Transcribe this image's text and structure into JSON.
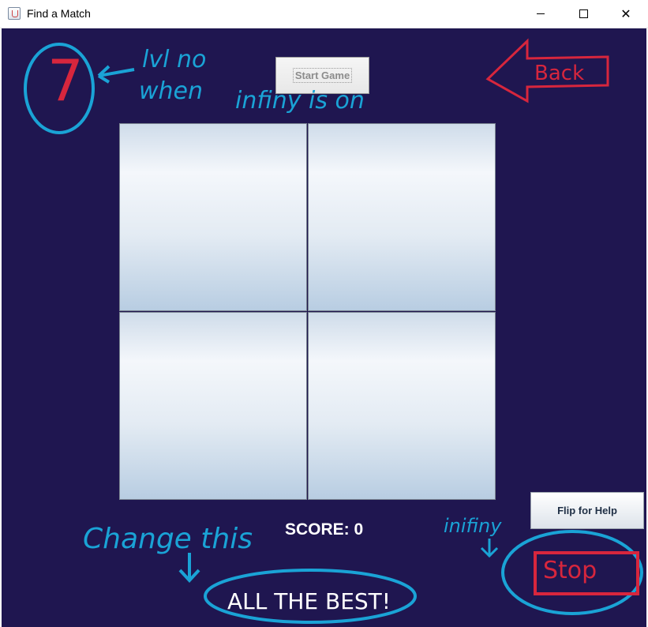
{
  "window": {
    "title": "Find a Match",
    "icons": {
      "app": "java-cup-icon",
      "minimize": "minimize-icon",
      "maximize": "maximize-icon",
      "close": "close-icon"
    }
  },
  "game": {
    "start_label": "Start Game",
    "score_label": "SCORE: 0",
    "flip_label": "Flip for Help",
    "best_label": "ALL THE BEST!",
    "cards": [
      {
        "name": "card-1"
      },
      {
        "name": "card-2"
      },
      {
        "name": "card-3"
      },
      {
        "name": "card-4"
      }
    ],
    "colors": {
      "background": "#1f1650"
    }
  },
  "annotations": {
    "level_number": "7",
    "lvl_no": "lvl no",
    "when": "when",
    "infiny_is_on": "infiny is on",
    "back": "Back",
    "change_this": "Change this",
    "infiny": "inifiny",
    "stop": "Stop",
    "colors": {
      "blue": "#1aa3d6",
      "red": "#d7263d"
    }
  }
}
